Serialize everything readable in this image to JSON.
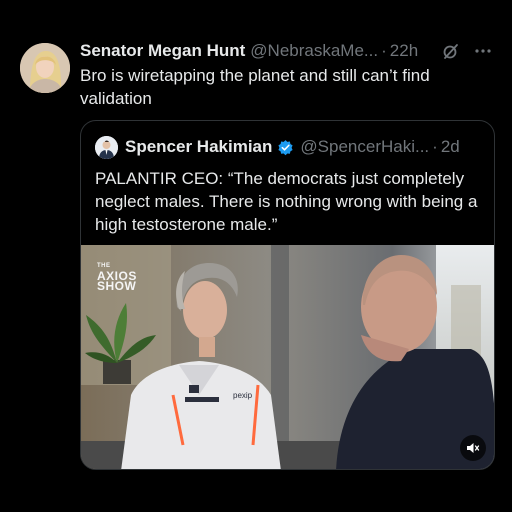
{
  "post": {
    "author_name": "Senator Megan Hunt",
    "author_handle": "@NebraskaMe...",
    "separator": "·",
    "time": "22h",
    "text": "Bro is wiretapping the planet and still can’t find validation"
  },
  "quoted_post": {
    "author_name": "Spencer Hakimian",
    "author_handle": "@SpencerHaki...",
    "separator": "·",
    "time": "2d",
    "text": "PALANTIR CEO: “The democrats just completely neglect males. There is nothing wrong with being a high testosterone male.”",
    "media": {
      "brand_line1": "THE",
      "brand_line2": "AXIOS",
      "brand_line3": "SHOW",
      "jacket_logo": "pexip"
    }
  },
  "icons": {
    "grok": "grok-icon",
    "more": "more-icon",
    "verified": "verified-badge-icon",
    "mute": "mute-icon"
  },
  "colors": {
    "background": "#000000",
    "text": "#e7e9ea",
    "secondary": "#71767b",
    "border": "#2f3336",
    "verified": "#1d9bf0"
  }
}
